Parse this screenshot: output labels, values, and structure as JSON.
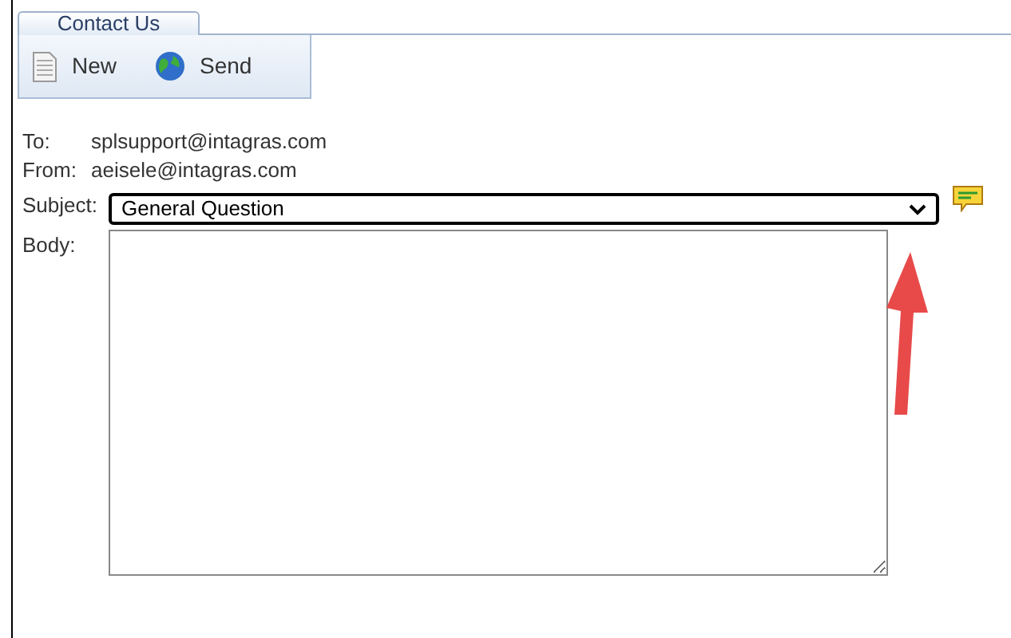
{
  "tabs": [
    {
      "label": "Contact Us",
      "selected": true
    }
  ],
  "toolbar": [
    {
      "kind": "new",
      "label": "New"
    },
    {
      "kind": "send",
      "label": "Send"
    }
  ],
  "fields": [
    {
      "label": "To:",
      "value": "splsupport@intagras.com"
    },
    {
      "label": "From:",
      "value": "aeisele@intagras.com"
    }
  ],
  "subject": {
    "label": "Subject:",
    "value": "General Question"
  },
  "body": {
    "label": "Body:"
  }
}
